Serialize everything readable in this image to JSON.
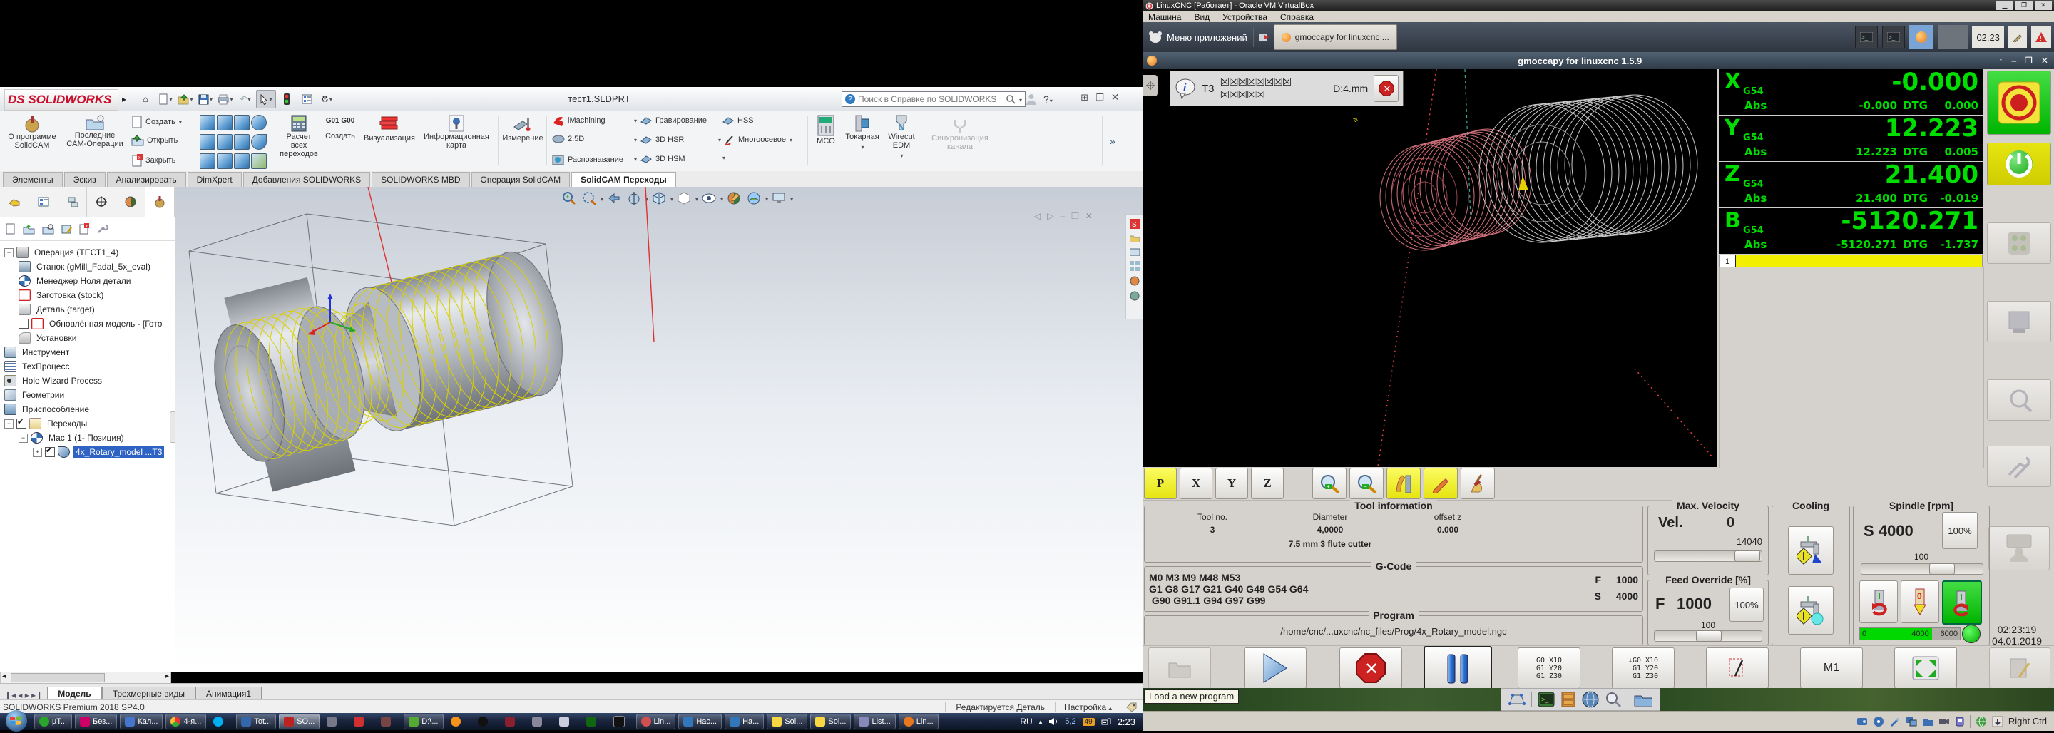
{
  "solidworks": {
    "logo": "DS SOLIDWORKS",
    "title": "тест1.SLDPRT",
    "search_placeholder": "Поиск в Справке по SOLIDWORKS",
    "ribbon": {
      "about": "О программе SolidCAM",
      "recent": "Последние CAM-Операции",
      "new": "Создать",
      "open": "Открыть",
      "close": "Закрыть",
      "calc": "Расчет всех переходов",
      "g01_icon": "G01 G00",
      "g01": "Создать",
      "viz": "Визуализация",
      "info": "Информационная карта",
      "measure": "Измерение",
      "imachining": "iMachining",
      "d25": "2.5D",
      "recognize": "Распознавание",
      "engrave": "Гравирование",
      "hsr": "3D HSR",
      "hsm": "3D HSM",
      "hss": "HSS",
      "multiaxis": "Многоосевое",
      "mco": "MCO",
      "lathe": "Токарная",
      "wirecut": "Wirecut EDM",
      "sync": "Синхронизация канала",
      "overflow": "»"
    },
    "tabs": [
      {
        "label": "Элементы",
        "cls": ""
      },
      {
        "label": "Эскиз",
        "cls": ""
      },
      {
        "label": "Анализировать",
        "cls": ""
      },
      {
        "label": "DimXpert",
        "cls": ""
      },
      {
        "label": "Добавления SOLIDWORKS",
        "cls": ""
      },
      {
        "label": "SOLIDWORKS MBD",
        "cls": ""
      },
      {
        "label": "Операция  SolidCAM",
        "cls": ""
      },
      {
        "label": "SolidCAM Переходы",
        "cls": "active"
      }
    ],
    "tree": [
      {
        "label": "Операция (ТЕСТ1_4)",
        "cls": "d0 exp",
        "ic": "ic-op"
      },
      {
        "label": "Станок (gMill_Fadal_5x_eval)",
        "cls": "d1",
        "ic": "ic-mach"
      },
      {
        "label": "Менеджер Ноля детали",
        "cls": "d1",
        "ic": "ic-zero"
      },
      {
        "label": "Заготовка (stock)",
        "cls": "d1",
        "ic": "ic-stock"
      },
      {
        "label": "Деталь (target)",
        "cls": "d1",
        "ic": "ic-part"
      },
      {
        "label": "Обновлённая модель - [Гото",
        "cls": "d1 unchk",
        "ic": "ic-stock"
      },
      {
        "label": "Установки",
        "cls": "d1",
        "ic": "ic-wrench"
      },
      {
        "label": "Инструмент",
        "cls": "d0",
        "ic": "ic-tool"
      },
      {
        "label": "ТехПроцесс",
        "cls": "d0",
        "ic": "ic-proc"
      },
      {
        "label": "Hole Wizard Process",
        "cls": "d0",
        "ic": "ic-hole"
      },
      {
        "label": "Геометрии",
        "cls": "d0",
        "ic": "ic-geom"
      },
      {
        "label": "Приспособление",
        "cls": "d0",
        "ic": "ic-fix"
      },
      {
        "label": "Переходы",
        "cls": "d0 exp chkd",
        "ic": "ic-fold"
      },
      {
        "label": "Мас 1 (1- Позиция)",
        "cls": "d1 exp",
        "ic": "ic-zero"
      },
      {
        "label": "4x_Rotary_model ...T3",
        "cls": "d2 plus chkd sel",
        "ic": "ic-rot"
      }
    ],
    "sheet_tabs": [
      {
        "label": "Модель",
        "cls": "active"
      },
      {
        "label": "Трехмерные виды",
        "cls": ""
      },
      {
        "label": "Анимация1",
        "cls": ""
      }
    ],
    "status": {
      "left": "SOLIDWORKS Premium 2018 SP4.0",
      "editing": "Редактируется Деталь",
      "config": "Настройка"
    }
  },
  "taskbar": {
    "items": [
      {
        "label": "µT...",
        "ico": "k-ut"
      },
      {
        "label": "Без...",
        "ico": "k-paint"
      },
      {
        "label": "Кал...",
        "ico": "k-calc"
      },
      {
        "label": "4-я...",
        "ico": "k-chrome"
      },
      {
        "label": "",
        "ico": "k-skype",
        "cls": "plain"
      },
      {
        "label": "Tot...",
        "ico": "k-tc"
      },
      {
        "label": "SO...",
        "ico": "k-sw",
        "cls": "activewin"
      },
      {
        "label": "",
        "ico": "k-printer",
        "cls": "plain"
      },
      {
        "label": "",
        "ico": "k-snow",
        "cls": "plain"
      },
      {
        "label": "",
        "ico": "k-acad",
        "cls": "plain"
      },
      {
        "label": "D:\\...",
        "ico": "k-note"
      },
      {
        "label": "",
        "ico": "k-btc",
        "cls": "plain"
      },
      {
        "label": "",
        "ico": "k-dot",
        "cls": "plain"
      },
      {
        "label": "",
        "ico": "k-vamp",
        "cls": "plain"
      },
      {
        "label": "",
        "ico": "k-v",
        "cls": "plain"
      },
      {
        "label": "",
        "ico": "k-search",
        "cls": "plain"
      },
      {
        "label": "",
        "ico": "k-scis",
        "cls": "plain"
      },
      {
        "label": "",
        "ico": "k-cmd",
        "cls": "plain"
      },
      {
        "label": "Lin...",
        "ico": "k-lin"
      },
      {
        "label": "Нас...",
        "ico": "k-set"
      },
      {
        "label": "На...",
        "ico": "k-set"
      },
      {
        "label": "Sol...",
        "ico": "k-sol"
      },
      {
        "label": "Sol...",
        "ico": "k-sol"
      },
      {
        "label": "List...",
        "ico": "k-list"
      },
      {
        "label": "Lin...",
        "ico": "k-gmoc"
      }
    ],
    "tray": {
      "lang": "RU",
      "badge1": "5,2",
      "badge2": "49",
      "clock": "2:23"
    }
  },
  "vbox": {
    "title": "LinuxCNC [Работает] - Oracle VM VirtualBox",
    "menu": [
      "Машина",
      "Вид",
      "Устройства",
      "Справка"
    ],
    "hint": "Right Ctrl"
  },
  "vm_panel": {
    "menu_label": "Меню приложений",
    "window_button": "gmoccapy for linuxcnc  ...",
    "clock": "02:23"
  },
  "gmoccapy": {
    "window_title": "gmoccapy for linuxcnc  1.5.9",
    "message": {
      "tool": "T3",
      "boxes": "☒☒☒☒☒☒☒☒ ☒☒☒☒☒",
      "detail": "D:4.mm"
    },
    "dro": {
      "abs_label": "Abs",
      "dtg_label": "DTG",
      "axes": [
        {
          "letter": "X",
          "system": "G54",
          "value": "-0.000",
          "abs": "-0.000",
          "dtg": "0.000"
        },
        {
          "letter": "Y",
          "system": "G54",
          "value": "12.223",
          "abs": "12.223",
          "dtg": "0.005"
        },
        {
          "letter": "Z",
          "system": "G54",
          "value": "21.400",
          "abs": "21.400",
          "dtg": "-0.019"
        },
        {
          "letter": "B",
          "system": "G54",
          "value": "-5120.271",
          "abs": "-5120.271",
          "dtg": "-1.737"
        }
      ],
      "line_no": "1"
    },
    "jog": [
      "P",
      "X",
      "Y",
      "Z"
    ],
    "tool_info": {
      "title": "Tool information",
      "tool_no_label": "Tool no.",
      "tool_no": "3",
      "diameter_label": "Diameter",
      "diameter": "4,0000",
      "offset_label": "offset z",
      "offset": "0.000",
      "description": "7.5 mm 3 flute cutter"
    },
    "gcode": {
      "title": "G-Code",
      "lines": [
        "M0 M3 M9 M48 M53",
        "G1 G8 G17 G21 G40 G49 G54 G64",
        " G90 G91.1 G94 G97 G99"
      ],
      "f_label": "F",
      "f_value": "1000",
      "s_label": "S",
      "s_value": "4000"
    },
    "program": {
      "title": "Program",
      "path": "/home/cnc/...uxcnc/nc_files/Prog/4x_Rotary_model.ngc"
    },
    "max_velocity": {
      "title": "Max. Velocity",
      "vel_label": "Vel.",
      "vel": "0",
      "max": "14040"
    },
    "feed_override": {
      "title": "Feed Override [%]",
      "f_label": "F",
      "value": "1000",
      "pct": "100%",
      "scale": "100"
    },
    "cooling": {
      "title": "Cooling"
    },
    "spindle": {
      "title": "Spindle [rpm]",
      "s_label": "S",
      "rpm": "4000",
      "pct": "100%",
      "scale": "100",
      "bar_min": "0",
      "bar_mid": "4000",
      "bar_max": "6000"
    },
    "datetime": {
      "time": "02:23:19",
      "date": "04.01.2019"
    },
    "tooltip": "Load a new program",
    "m1_label": "M1",
    "gcode_snippet": [
      "G0 X10",
      "G1 Y20",
      "G1 Z30"
    ]
  }
}
